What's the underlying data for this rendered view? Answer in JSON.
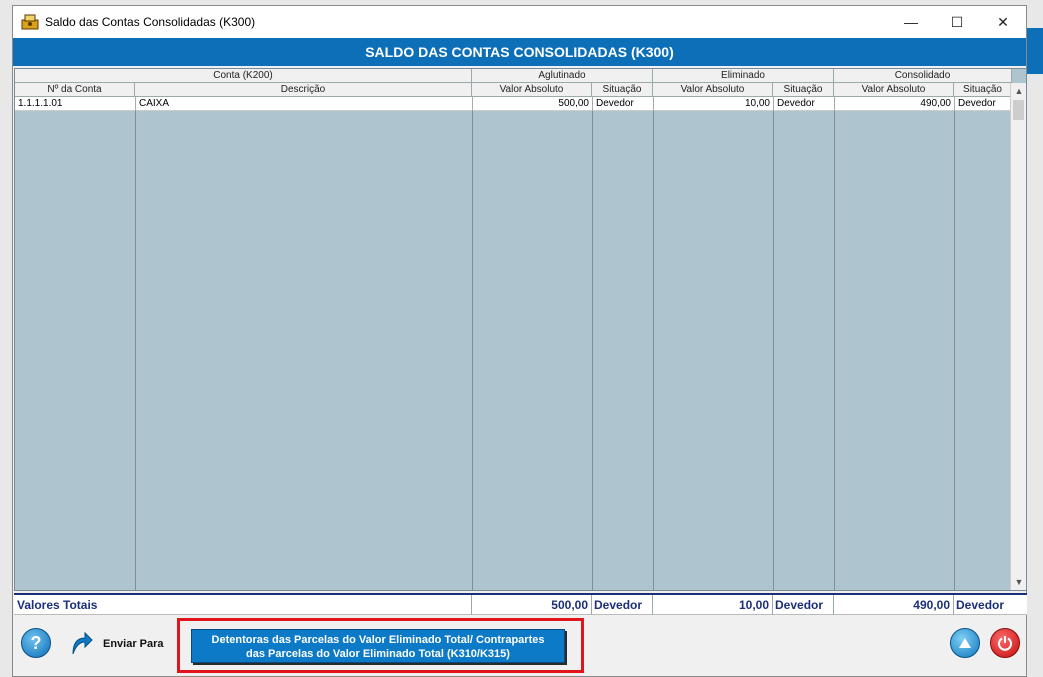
{
  "window": {
    "title": "Saldo das Contas Consolidadas (K300)",
    "minimize_glyph": "—",
    "maximize_glyph": "☐",
    "close_glyph": "✕"
  },
  "header": {
    "title": "SALDO DAS CONTAS CONSOLIDADAS (K300)"
  },
  "grid": {
    "groups": {
      "conta": "Conta (K200)",
      "aglutinado": "Aglutinado",
      "eliminado": "Eliminado",
      "consolidado": "Consolidado"
    },
    "columns": {
      "numero": "Nº da Conta",
      "descricao": "Descrição",
      "ag_valor": "Valor Absoluto",
      "ag_situacao": "Situação",
      "el_valor": "Valor Absoluto",
      "el_situacao": "Situação",
      "co_valor": "Valor Absoluto",
      "co_situacao": "Situação"
    },
    "rows": [
      {
        "numero": "1.1.1.1.01",
        "descricao": "CAIXA",
        "ag_valor": "500,00",
        "ag_situacao": "Devedor",
        "el_valor": "10,00",
        "el_situacao": "Devedor",
        "co_valor": "490,00",
        "co_situacao": "Devedor"
      }
    ]
  },
  "totals": {
    "label": "Valores Totais",
    "ag_valor": "500,00",
    "ag_situacao": "Devedor",
    "el_valor": "10,00",
    "el_situacao": "Devedor",
    "co_valor": "490,00",
    "co_situacao": "Devedor"
  },
  "footer": {
    "help_glyph": "?",
    "send_label": "Enviar Para",
    "k310_line1": "Detentoras das Parcelas  do Valor Eliminado Total/ Contrapartes",
    "k310_line2": "das Parcelas do Valor Eliminado Total (K310/K315)"
  },
  "colors": {
    "header_blue": "#0d6fb8",
    "grid_bg": "#aec4cf",
    "totals_text": "#1b2f7a",
    "highlight_red": "#e0151b"
  }
}
